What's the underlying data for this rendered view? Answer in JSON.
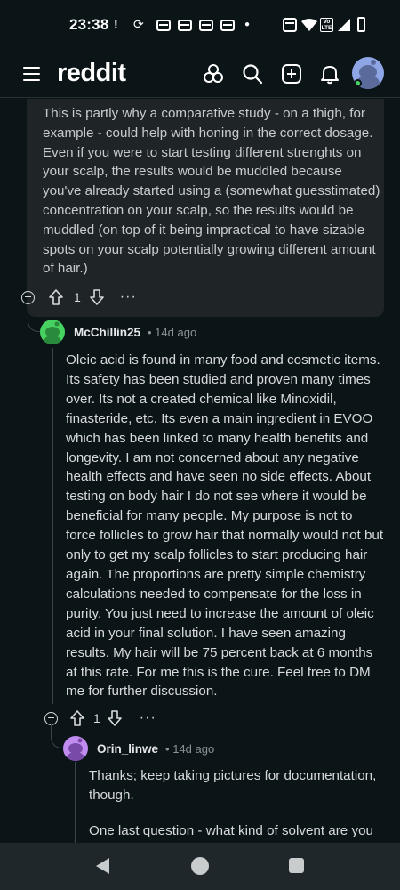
{
  "status_bar": {
    "time": "23:38",
    "icons": [
      "alert-icon",
      "sync-icon",
      "message-icon",
      "message-icon",
      "message-icon",
      "message-icon",
      "dot-icon",
      "nfc-icon",
      "wifi-icon",
      "volte-icon",
      "signal-icon",
      "battery-icon"
    ],
    "volte_label": "Vo LTE"
  },
  "header": {
    "logo": "reddit",
    "icons": [
      "menu-icon",
      "community-icon",
      "search-icon",
      "create-post-icon",
      "notifications-icon",
      "avatar"
    ]
  },
  "parent_comment": {
    "text": "This is partly why a comparative study - on a thigh, for example - could help with honing in the correct dosage. Even if you were to start testing different strenghts on your scalp, the results would be muddled because you've already started using a (somewhat guesstimated) concentration on your scalp, so the results would be muddled (on top of it being impractical to have sizable spots on your scalp potentially growing different amount of hair.)",
    "votes": "1",
    "more": "···"
  },
  "comment_1": {
    "username": "McChillin25",
    "time": "• 14d ago",
    "text": "Oleic acid is found in many food and cosmetic items. Its safety has been studied and proven many times over. Its not a created chemical like Minoxidil, finasteride, etc. Its even a main ingredient in EVOO which has been linked to many health benefits and longevity. I am not concerned about any negative health effects and have seen no side effects. About testing on body hair I do not see where it would be beneficial for many people. My purpose is not to force follicles to grow hair that normally would not but only to get my scalp follicles to start producing hair again. The proportions are pretty simple chemistry calculations needed to compensate for the loss in purity. You just need to increase the amount of oleic acid in your final solution. I have seen amazing results. My hair will be 75 percent back at 6 months at this rate. For me this is the cure. Feel free to DM me for further discussion.",
    "votes": "1",
    "more": "···",
    "avatar_color": "#46d160"
  },
  "comment_2": {
    "username": "Orin_linwe",
    "time": "• 14d ago",
    "paragraph_1": "Thanks; keep taking pictures for documentation, though.",
    "paragraph_2": "One last question - what kind of solvent are you",
    "avatar_color": "#c18cf0"
  },
  "navigation": {
    "icons": [
      "back-icon",
      "home-icon",
      "recents-icon"
    ]
  }
}
